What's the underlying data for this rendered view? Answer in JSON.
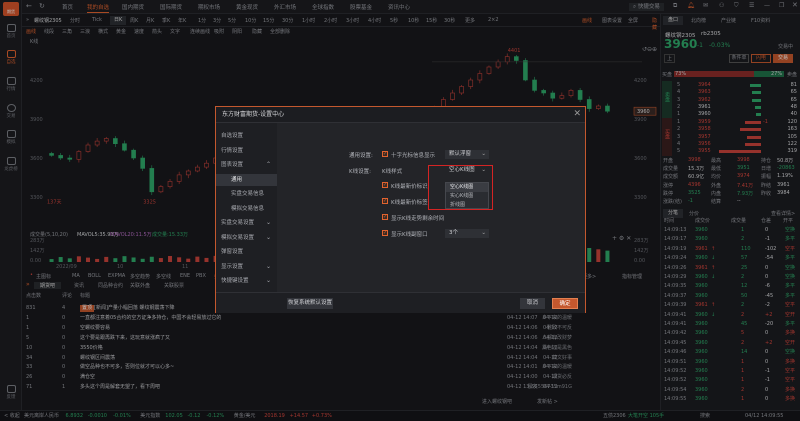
{
  "colors": {
    "accent": "#e2632f",
    "up": "#d8473e",
    "down": "#2fa86a",
    "background": "#18191d",
    "highlight": "#d42424"
  },
  "sidebar": {
    "logo": "期货",
    "items": [
      {
        "label": "首页",
        "icon": "grid-icon"
      },
      {
        "label": "自选",
        "icon": "star-box-icon"
      },
      {
        "label": "行情",
        "icon": "chart-icon"
      },
      {
        "label": "交易",
        "icon": "yuan-icon"
      },
      {
        "label": "模拟",
        "icon": "gamepad-icon"
      },
      {
        "label": "龙虎榜",
        "icon": "database-icon"
      }
    ],
    "feedback": "反馈"
  },
  "topnav": {
    "tabs": [
      "首页",
      "我的自选",
      "国内期货",
      "国际期货",
      "期权市场",
      "黄金现货",
      "外汇市场",
      "全球指数",
      "股票基金",
      "资讯中心"
    ],
    "active": 1,
    "quick_trade": "快捷交易"
  },
  "periods": {
    "contract": "螺纹钢2305",
    "items": [
      "分时",
      "Tick",
      "日K",
      "周K",
      "月K",
      "季K",
      "年K",
      "1分",
      "3分",
      "5分",
      "10分",
      "15分",
      "30分",
      "1小时",
      "2小时",
      "3小时",
      "4小时",
      "5秒",
      "10秒",
      "15秒",
      "30秒",
      "更多",
      "2×2"
    ],
    "active": 2,
    "actions": [
      "画线",
      "图表设置",
      "全屏",
      "隐藏"
    ]
  },
  "tools": {
    "items": [
      "画线",
      "线段",
      "三角",
      "三浪",
      "横式",
      "黄金",
      "速度",
      "箭头",
      "文字",
      "连续画线",
      "吸附",
      "阴阳",
      "隐藏",
      "全部删除"
    ],
    "sub": "K线"
  },
  "chart": {
    "y_ticks": [
      4200,
      3900,
      3600,
      3300
    ],
    "x_ticks": [
      "2022/09",
      "10",
      "11"
    ],
    "high_label": "4401",
    "low_label": "3325",
    "days_label": "137天",
    "last_price": "3960",
    "volume_legend": {
      "label": "成交量(5,10,20)",
      "mavol5": "MAVOL5:35.91万",
      "mavol20": "MAVOL20:11.5万",
      "vol": "成交量:15.33万"
    },
    "vol_ticks": [
      "283万",
      "142万",
      "0.00"
    ]
  },
  "chart_data": {
    "type": "candlestick",
    "ylim": [
      3250,
      4450
    ],
    "closes": [
      3620,
      3600,
      3590,
      3650,
      3700,
      3730,
      3750,
      3710,
      3660,
      3600,
      3520,
      3340,
      3380,
      3420,
      3470,
      3500,
      3530,
      3560,
      3600,
      3650,
      3700,
      3740,
      3760,
      3720,
      3800,
      3850,
      3880,
      3860,
      3820,
      3790,
      3770,
      3800,
      3840,
      3870,
      3900,
      3880,
      3850,
      3900,
      3920,
      3880,
      3900,
      3950,
      3990,
      4050,
      4100,
      4150,
      4200,
      4250,
      4300,
      4340,
      4380,
      4350,
      4200,
      4120,
      4100,
      4060,
      4080,
      4120,
      4050,
      3980,
      4000,
      3960
    ]
  },
  "indicators": {
    "items": [
      "主图标",
      "MA",
      "BOLL",
      "EXPMA",
      "多空趋势",
      "多空线",
      "ENE",
      "PBX",
      "叠加"
    ],
    "active": 8,
    "more": "更多>",
    "manage": "指标管理"
  },
  "bottom_tabs": {
    "items": [
      "期货吧",
      "资讯",
      "同品种合约",
      "关联外盘",
      "关联股票"
    ],
    "active": 0
  },
  "forum": {
    "headers": [
      "点击数",
      "评论",
      "标题",
      "作者",
      "最后更新",
      "发表日"
    ],
    "rows": [
      {
        "clicks": "831",
        "comments": "4",
        "tag": "置顶",
        "title": "[新闻]产量小幅回落 螺纹钢震荡下降",
        "author": "资讯",
        "updated": "04-12 13:56",
        "date": "04-12"
      },
      {
        "clicks": "1",
        "comments": "0",
        "title": "一直都注意着05合约的空方证净多持仓，中国不会轻易放过它的",
        "author": "乡下来的温暖",
        "updated": "04-12 14:07",
        "date": "04-12"
      },
      {
        "clicks": "1",
        "comments": "0",
        "title": "空螺纹要容易",
        "author": "雅致不可反",
        "updated": "04-12 14:06",
        "date": "04-12"
      },
      {
        "clicks": "5",
        "comments": "0",
        "title": "这个要是跟再跌下来，这玩意就涨疯了又",
        "author": "人都有改财梦",
        "updated": "04-12 14:06",
        "date": "04-12"
      },
      {
        "clicks": "10",
        "comments": "0",
        "title": "3550价格",
        "author": "黑色还是黑色",
        "updated": "04-12 14:04",
        "date": "04-12"
      },
      {
        "clicks": "34",
        "comments": "0",
        "title": "螺纹钢区间震荡",
        "author": "藏文好事",
        "updated": "04-12 14:04",
        "date": "04-12"
      },
      {
        "clicks": "33",
        "comments": "0",
        "title": "做空品种也不可多，否则位就才可以心多~",
        "author": "乡下来的温暖",
        "updated": "04-12 14:01",
        "date": "04-12"
      },
      {
        "clicks": "26",
        "comments": "0",
        "title": "满仓空",
        "author": "期货必反",
        "updated": "04-12 14:00",
        "date": "04-12"
      },
      {
        "clicks": "71",
        "comments": "1",
        "title": "多头这个周是解套无望了，看下周吧",
        "author": "股友556735m91G",
        "updated": "04-12 13:56",
        "date": "04-12"
      }
    ],
    "enter_bar": "进入螺纹钢吧",
    "new_post": "发新帖 >"
  },
  "status": {
    "collapse": "< 收起",
    "items": [
      {
        "name": "美元离岸人民币",
        "price": "6.8932",
        "chg": "-0.0010",
        "pct": "-0.01%",
        "dir": "down"
      },
      {
        "name": "美元指数",
        "price": "102.05",
        "chg": "-0.12",
        "pct": "-0.12%",
        "dir": "down"
      },
      {
        "name": "黄金/美元",
        "price": "2018.19",
        "chg": "+14.57",
        "pct": "+0.73%",
        "dir": "up"
      }
    ],
    "ticker": "五债2306",
    "ticker_msg": "大笔开空 105手"
  },
  "right": {
    "tabs": [
      "盘口",
      "北向榜",
      "产业链",
      "F10资料"
    ],
    "name": "螺纹钢2305",
    "code": "rb2305",
    "price": "3960",
    "chg": "-1",
    "pct": "-0.03%",
    "state": "交易中",
    "buttons": [
      "上",
      "条件单",
      "闪电",
      "交易"
    ],
    "buy_label": "买盘",
    "sell_label": "卖盘",
    "buy_pct": 73,
    "sell_pct": 27,
    "ask_label": "卖盘",
    "bid_label": "买盘",
    "asks": [
      {
        "lvl": "5",
        "p": "3964",
        "v": "81"
      },
      {
        "lvl": "4",
        "p": "3963",
        "v": "65"
      },
      {
        "lvl": "3",
        "p": "3962",
        "v": "65"
      },
      {
        "lvl": "2",
        "p": "3961",
        "v": "48"
      },
      {
        "lvl": "1",
        "p": "3960",
        "v": "40"
      }
    ],
    "bids": [
      {
        "lvl": "1",
        "p": "3959",
        "v": "120",
        "d": "-1"
      },
      {
        "lvl": "2",
        "p": "3958",
        "v": "163"
      },
      {
        "lvl": "3",
        "p": "3957",
        "v": "105"
      },
      {
        "lvl": "4",
        "p": "3956",
        "v": "122"
      },
      {
        "lvl": "5",
        "p": "3955",
        "v": "319"
      }
    ],
    "stats": [
      [
        "开盘",
        "3998",
        "最高",
        "3998",
        "持仓",
        "50.8万"
      ],
      [
        "成交量",
        "15.3万",
        "最低",
        "3951",
        "日增",
        "-20863"
      ],
      [
        "成交额",
        "60.9亿",
        "均价",
        "3974",
        "振幅",
        "1.19%"
      ],
      [
        "涨停",
        "4396",
        "外盘",
        "7.41万",
        "昨结",
        "3961"
      ],
      [
        "跌停",
        "3525",
        "内盘",
        "7.93万",
        "昨收",
        "3984"
      ],
      [
        "涨跌(结)",
        "-1",
        "结算",
        "--",
        "",
        ""
      ]
    ],
    "trade_tabs": [
      "分笔",
      "分价"
    ],
    "detail": "查看详情>",
    "trade_headers": [
      "时间",
      "成交价",
      "成交量",
      "仓差",
      "开平"
    ],
    "trades": [
      [
        "14:09:13",
        "3960",
        "",
        "1",
        "0",
        "空换"
      ],
      [
        "14:09:17",
        "3960",
        "",
        "2",
        "-1",
        "多平"
      ],
      [
        "14:09:19",
        "3961",
        "↑",
        "110",
        "-102",
        "空平"
      ],
      [
        "14:09:24",
        "3960",
        "↓",
        "57",
        "-54",
        "多平"
      ],
      [
        "14:09:26",
        "3961",
        "↑",
        "25",
        "0",
        "空换"
      ],
      [
        "14:09:29",
        "3960",
        "↓",
        "2",
        "0",
        "空换"
      ],
      [
        "14:09:35",
        "3960",
        "",
        "12",
        "-6",
        "多平"
      ],
      [
        "14:09:37",
        "3960",
        "",
        "50",
        "-45",
        "多平"
      ],
      [
        "14:09:39",
        "3961",
        "↑",
        "2",
        "-2",
        "空平"
      ],
      [
        "14:09:41",
        "3960",
        "↓",
        "2",
        "+2",
        "空开"
      ],
      [
        "14:09:41",
        "3960",
        "",
        "45",
        "-20",
        "多平"
      ],
      [
        "14:09:42",
        "3960",
        "",
        "5",
        "0",
        "多换"
      ],
      [
        "14:09:45",
        "3960",
        "",
        "2",
        "+2",
        "空开"
      ],
      [
        "14:09:46",
        "3960",
        "",
        "14",
        "0",
        "空换"
      ],
      [
        "14:09:51",
        "3960",
        "",
        "1",
        "0",
        "多换"
      ],
      [
        "14:09:52",
        "3960",
        "",
        "1",
        "-1",
        "空平"
      ],
      [
        "14:09:52",
        "3960",
        "",
        "1",
        "-1",
        "空平"
      ],
      [
        "14:09:54",
        "3960",
        "",
        "2",
        "0",
        "多换"
      ],
      [
        "14:09:55",
        "3960",
        "",
        "1",
        "0",
        "多换"
      ]
    ],
    "search_placeholder": "搜索",
    "clock": "04/12 14:09:55"
  },
  "dialog": {
    "title": "东方财富期货-设置中心",
    "nav": [
      {
        "label": "自选设置"
      },
      {
        "label": "行情设置"
      },
      {
        "label": "图表设置",
        "chev": "^"
      },
      {
        "label": "通用",
        "sub": true,
        "active": true
      },
      {
        "label": "实盘交易信息",
        "sub": true
      },
      {
        "label": "模拟交易信息",
        "sub": true
      },
      {
        "label": "实盘交易设置",
        "chev": "v"
      },
      {
        "label": "模拟交易设置",
        "chev": "v"
      },
      {
        "label": "弹窗设置"
      },
      {
        "label": "显示设置",
        "chev": "v"
      },
      {
        "label": "快捷键设置",
        "chev": "v"
      },
      {
        "label": "常规设置"
      }
    ],
    "general_label": "通用设置:",
    "crosshair": {
      "label": "十字光标信息显示",
      "checked": true,
      "value": "默认浮窗"
    },
    "kline_label": "K线设置:",
    "kline_style": {
      "label": "K线样式",
      "value": "空心K线图",
      "options": [
        "空心K线图",
        "实心K线图",
        "折线图"
      ],
      "highlighted": 0
    },
    "options": [
      {
        "label": "K线最新价标识",
        "checked": true
      },
      {
        "label": "K线最新价标签",
        "checked": true
      },
      {
        "label": "显示K线走势剩余时间",
        "checked": true
      },
      {
        "label": "显示K线副窗口",
        "checked": true,
        "value": "3个"
      }
    ],
    "restore": "恢复系统默认设置",
    "cancel": "取消",
    "ok": "确定"
  }
}
